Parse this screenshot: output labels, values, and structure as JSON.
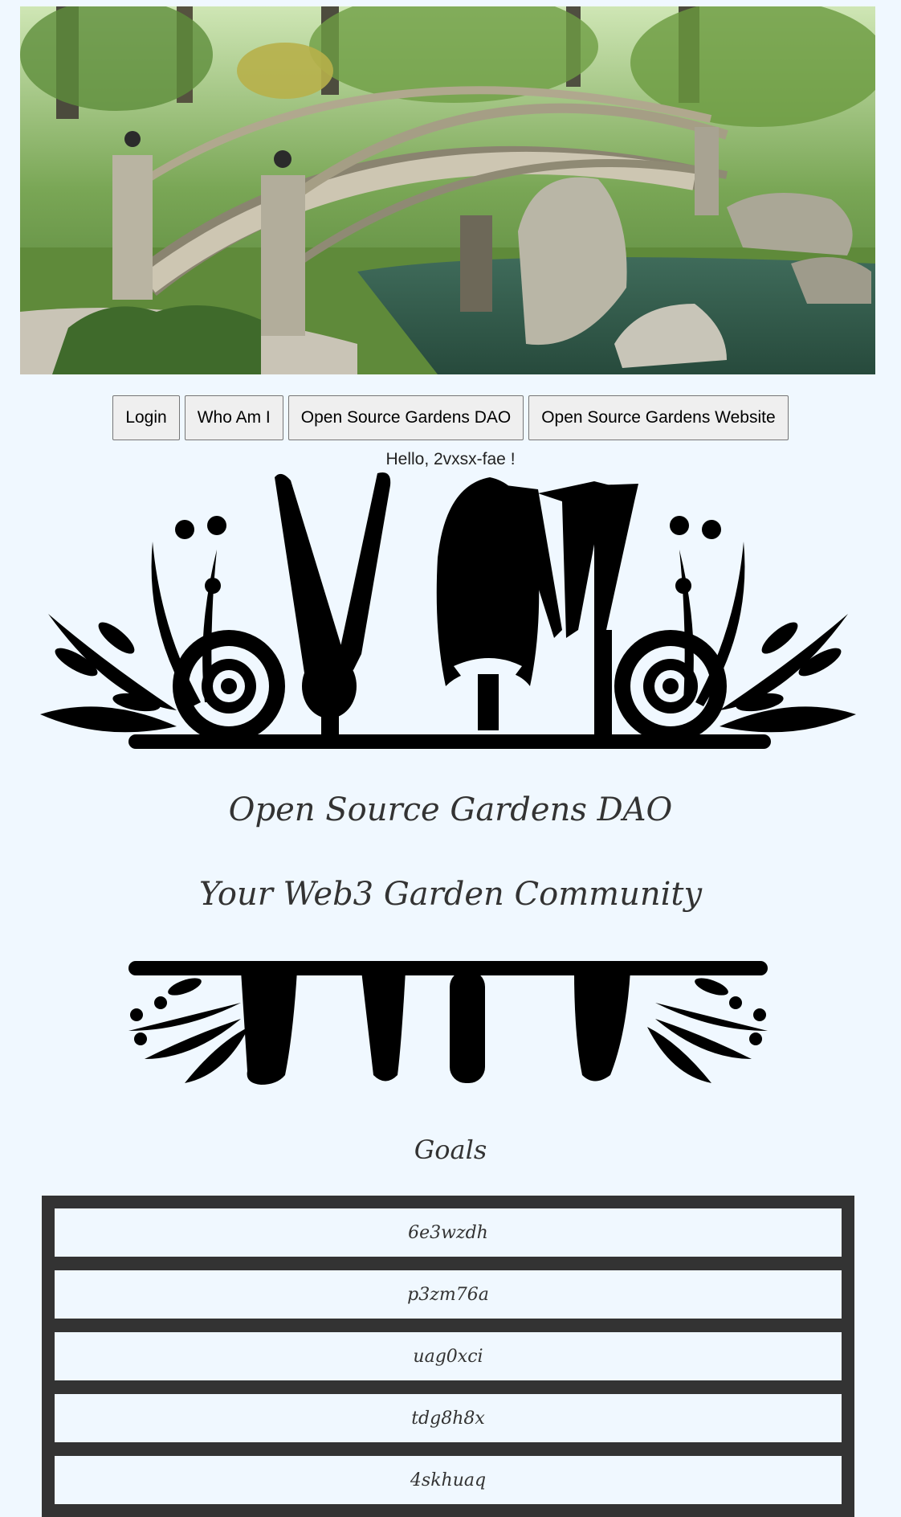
{
  "hero": {
    "image": "japanese-garden-arched-bridge"
  },
  "nav": {
    "buttons": [
      "Login",
      "Who Am I",
      "Open Source Gardens DAO",
      "Open Source Gardens Website"
    ]
  },
  "greeting": "Hello, 2vxsx-fae !",
  "title": "Open Source Gardens DAO",
  "subtitle": "Your Web3 Garden Community",
  "goals": {
    "heading": "Goals",
    "items": [
      "6e3wzdh",
      "p3zm76a",
      "uag0xci",
      "tdg8h8x",
      "4skhuaq"
    ]
  },
  "colors": {
    "page_bg": "#f0f8ff",
    "goal_frame": "#333333",
    "ornament": "#000000"
  }
}
